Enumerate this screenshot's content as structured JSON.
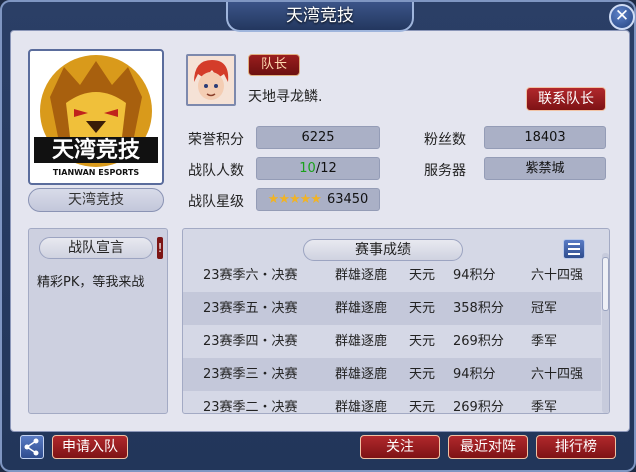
{
  "window": {
    "title": "天湾竞技"
  },
  "team": {
    "name": "天湾竞技",
    "logo_text_cn": "天湾竞技",
    "logo_text_en": "TIANWAN ESPORTS"
  },
  "captain": {
    "badge": "队长",
    "name": "天地寻龙鳞.",
    "contact_label": "联系队长"
  },
  "stats": {
    "honor_label": "荣誉积分",
    "honor_value": "6225",
    "fans_label": "粉丝数",
    "fans_value": "18403",
    "members_label": "战队人数",
    "members_current": "10",
    "members_max": "/12",
    "server_label": "服务器",
    "server_value": "紫禁城",
    "star_label": "战队星级",
    "star_rating": 5,
    "star_value": "63450"
  },
  "declaration": {
    "title": "战队宣言",
    "text": "精彩PK，等我来战"
  },
  "results": {
    "title": "赛事成绩",
    "rows": [
      {
        "event": "23赛季六・决赛",
        "mode": "群雄逐鹿",
        "server": "天元",
        "points": "94积分",
        "rank": "六十四强"
      },
      {
        "event": "23赛季五・决赛",
        "mode": "群雄逐鹿",
        "server": "天元",
        "points": "358积分",
        "rank": "冠军"
      },
      {
        "event": "23赛季四・决赛",
        "mode": "群雄逐鹿",
        "server": "天元",
        "points": "269积分",
        "rank": "季军"
      },
      {
        "event": "23赛季三・决赛",
        "mode": "群雄逐鹿",
        "server": "天元",
        "points": "94积分",
        "rank": "六十四强"
      },
      {
        "event": "23赛季二・决赛",
        "mode": "群雄逐鹿",
        "server": "天元",
        "points": "269积分",
        "rank": "季军"
      }
    ]
  },
  "footer": {
    "apply_label": "申请入队",
    "follow_label": "关注",
    "recent_label": "最近对阵",
    "ranking_label": "排行榜"
  },
  "colors": {
    "frame": "#2b3f66",
    "button_red": "#9a1e1e",
    "panel": "#e4e5ef",
    "star": "#f0b326",
    "member_highlight": "#1aa11a"
  }
}
